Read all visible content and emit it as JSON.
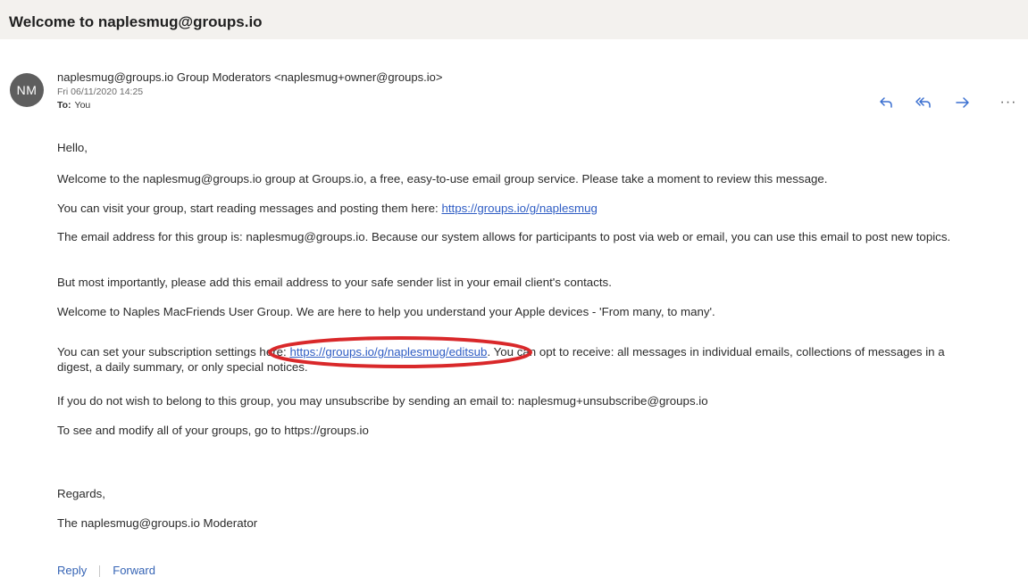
{
  "email": {
    "subject": "Welcome to naplesmug@groups.io",
    "sender": {
      "initials": "NM",
      "display": "naplesmug@groups.io Group Moderators <naplesmug+owner@groups.io>",
      "date": "Fri 06/11/2020 14:25",
      "to_label": "To:",
      "to_value": "You"
    },
    "actions": [
      "reply-icon",
      "reply-all-icon",
      "forward-icon",
      "more-icon"
    ],
    "more_label": "···",
    "body": {
      "greeting": "Hello,",
      "p1": "Welcome to the naplesmug@groups.io group at Groups.io, a free, easy-to-use email group service. Please take a moment to review this message.",
      "p2_text": "You can visit your group, start reading messages and posting them here: ",
      "p2_link": "https://groups.io/g/naplesmug",
      "p3": "The email address for this group is: naplesmug@groups.io. Because our system allows for participants to post via web or email, you can use this email to post new topics.",
      "p4": "But most importantly, please add this email address to your safe sender list in your email client's contacts.",
      "p5": "Welcome to Naples MacFriends User Group. We are here to help you understand your Apple devices - 'From many, to many'.",
      "p6_text_before": "You can set your subscription settings here: ",
      "p6_link": "https://groups.io/g/naplesmug/editsub",
      "p6_text_after": ". You can opt to receive: all messages in individual emails, collections of messages in a digest, a daily summary, or only special notices.",
      "p7": "If you do not wish to belong to this group, you may unsubscribe by sending an email to: naplesmug+unsubscribe@groups.io",
      "p8": "To see and modify all of your groups, go to https://groups.io",
      "p9": "Regards,",
      "p10": "The naplesmug@groups.io Moderator"
    },
    "footer": {
      "reply_label": "Reply",
      "forward_label": "Forward"
    }
  },
  "colors": {
    "link": "#2f5dc4",
    "annotation": "#d9282a",
    "avatar_bg": "#5e5e5e",
    "subject_bar": "#f3f1ee",
    "action_icon": "#3a6fd0"
  }
}
